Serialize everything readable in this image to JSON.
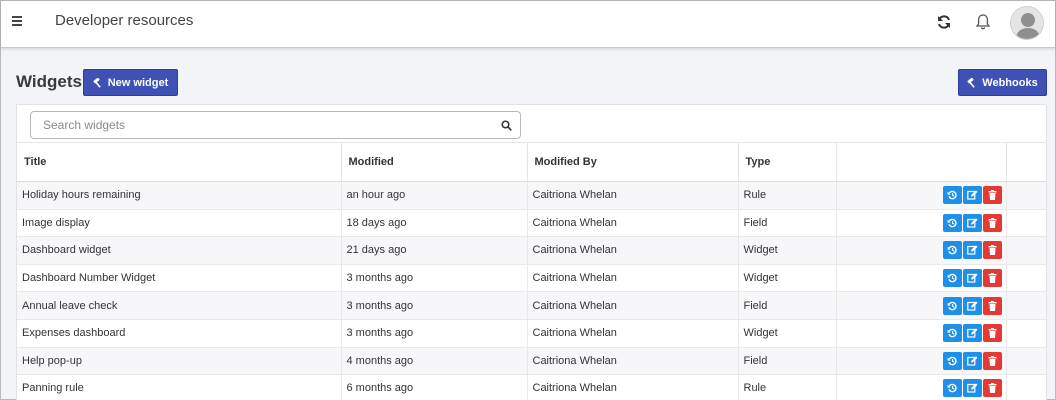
{
  "header": {
    "title": "Developer resources",
    "menu_icon": "hamburger-menu-icon",
    "refresh_icon": "refresh-icon",
    "notifications_icon": "bell-icon",
    "avatar_icon": "user-avatar-icon"
  },
  "page": {
    "title": "Widgets",
    "new_widget_label": "New widget",
    "webhooks_label": "Webhooks",
    "button_icon": "hammer-icon"
  },
  "search": {
    "placeholder": "Search widgets",
    "value": "",
    "icon": "search-icon"
  },
  "table": {
    "columns": [
      "Title",
      "Modified",
      "Modified By",
      "Type",
      ""
    ],
    "rows": [
      {
        "title": "Holiday hours remaining",
        "modified": "an hour ago",
        "modified_by": "Caitriona Whelan",
        "type": "Rule"
      },
      {
        "title": "Image display",
        "modified": "18 days ago",
        "modified_by": "Caitriona Whelan",
        "type": "Field"
      },
      {
        "title": "Dashboard widget",
        "modified": "21 days ago",
        "modified_by": "Caitriona Whelan",
        "type": "Widget"
      },
      {
        "title": "Dashboard Number Widget",
        "modified": "3 months ago",
        "modified_by": "Caitriona Whelan",
        "type": "Widget"
      },
      {
        "title": "Annual leave check",
        "modified": "3 months ago",
        "modified_by": "Caitriona Whelan",
        "type": "Field"
      },
      {
        "title": "Expenses dashboard",
        "modified": "3 months ago",
        "modified_by": "Caitriona Whelan",
        "type": "Widget"
      },
      {
        "title": "Help pop-up",
        "modified": "4 months ago",
        "modified_by": "Caitriona Whelan",
        "type": "Field"
      },
      {
        "title": "Panning rule",
        "modified": "6 months ago",
        "modified_by": "Caitriona Whelan",
        "type": "Rule"
      }
    ],
    "row_action_icons": [
      "history-icon",
      "edit-icon",
      "trash-icon"
    ]
  },
  "colors": {
    "primary": "#3f51b5",
    "action_blue": "#1e90e8",
    "action_red": "#e53935",
    "page_background": "#f3f4f8"
  }
}
